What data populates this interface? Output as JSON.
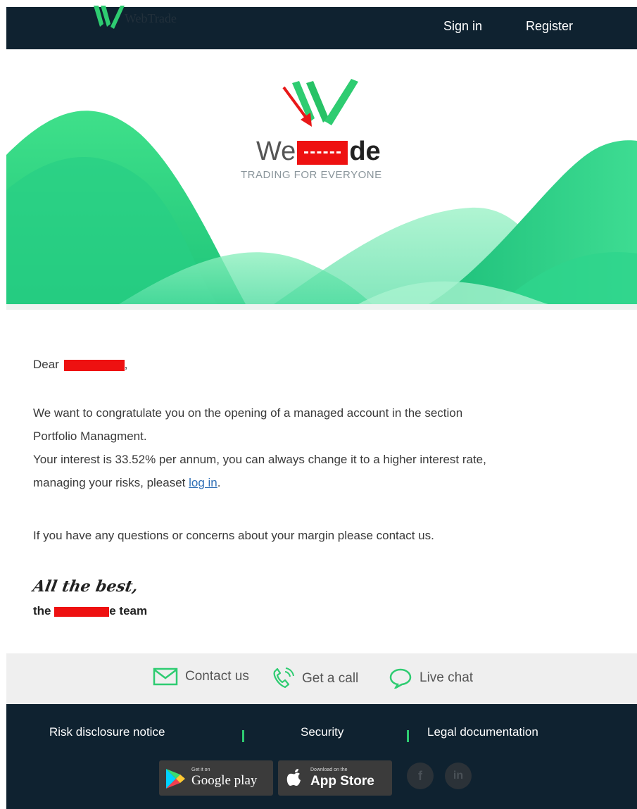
{
  "header": {
    "logo_text": "WebTrade",
    "signin_label": "Sign in",
    "register_label": "Register"
  },
  "hero": {
    "brand_prefix": "We",
    "brand_suffix": "de",
    "tagline": "TRADING FOR EVERYONE"
  },
  "email": {
    "greeting_prefix": "Dear",
    "greeting_suffix": ",",
    "para1_line1": "We want to congratulate you on the opening of a managed account in the section",
    "para1_line2": "Portfolio Managment.",
    "para2_line1": "Your interest is 33.52% per annum, you can always change it to a higher interest rate,",
    "para2_line2_prefix": "managing your risks, pleaset",
    "login_link": "log in",
    "para2_line2_suffix": ".",
    "para3": "If you have any questions or concerns about your margin please contact us.",
    "signoff_script": "All the best,",
    "signoff_team_prefix": "the",
    "signoff_team_suffix": "e team"
  },
  "contact": {
    "contact_us": "Contact us",
    "get_call": "Get a call",
    "live_chat": "Live chat"
  },
  "footer": {
    "risk": "Risk disclosure notice",
    "security": "Security",
    "legal": "Legal documentation",
    "google_small": "Get it on",
    "google_big": "Google play",
    "apple_small": "Download on the",
    "apple_big": "App Store",
    "facebook": "f",
    "linkedin": "in"
  },
  "colors": {
    "navy": "#0f2230",
    "green": "#2ecc71",
    "redaction": "#ee1111"
  }
}
